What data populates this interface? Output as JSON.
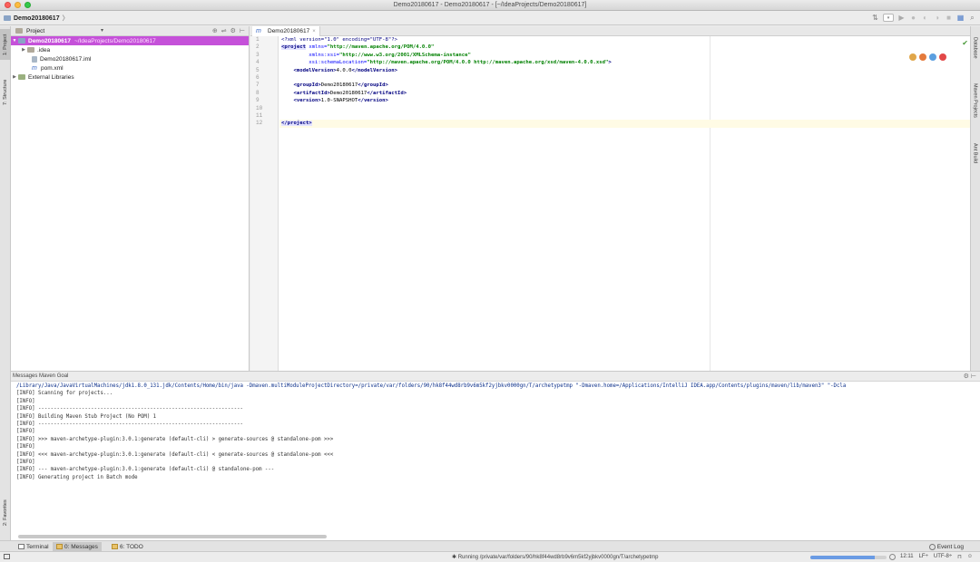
{
  "window": {
    "title": "Demo20180617 - Demo20180617 - [~/IdeaProjects/Demo20180617]"
  },
  "navbar": {
    "crumb": "Demo20180617"
  },
  "left_stripe": {
    "project_tab": "1: Project",
    "structure_tab": "7: Structure",
    "favorites_tab": "2: Favorites"
  },
  "right_stripe": {
    "database_tab": "Database",
    "maven_tab": "Maven Projects",
    "ant_tab": "Ant Build"
  },
  "project_panel": {
    "header": "Project",
    "tree": [
      {
        "name": "Demo20180617",
        "path": "~/IdeaProjects/Demo20180617"
      },
      {
        "name": ".idea"
      },
      {
        "name": "Demo20180617.iml"
      },
      {
        "name": "pom.xml"
      },
      {
        "name": "External Libraries"
      }
    ]
  },
  "editor": {
    "tab_label": "Demo20180617",
    "line_numbers": [
      "1",
      "2",
      "3",
      "4",
      "5",
      "6",
      "7",
      "8",
      "9",
      "10",
      "11",
      "12"
    ],
    "code": {
      "l1": "<?xml version=\"1.0\" encoding=\"UTF-8\"?>",
      "l2_tag": "<project",
      "l2_attr": " xmlns=",
      "l2_val": "\"http://maven.apache.org/POM/4.0.0\"",
      "l3_attr": "         xmlns:xsi=",
      "l3_val": "\"http://www.w3.org/2001/XMLSchema-instance\"",
      "l4_attr": "         xsi:schemaLocation=",
      "l4_val": "\"http://maven.apache.org/POM/4.0.0 http://maven.apache.org/xsd/maven-4.0.0.xsd\"",
      "l4_end": ">",
      "l5_open": "    <modelVersion>",
      "l5_text": "4.0.0",
      "l5_close": "</modelVersion>",
      "l7_open": "    <groupId>",
      "l7_text": "Demo20180617",
      "l7_close": "</groupId>",
      "l8_open": "    <artifactId>",
      "l8_text": "Demo20180617",
      "l8_close": "</artifactId>",
      "l9_open": "    <version>",
      "l9_text": "1.0-SNAPSHOT",
      "l9_close": "</version>",
      "l12": "</project>"
    }
  },
  "messages": {
    "header": "Messages Maven Goal",
    "lines": [
      "/Library/Java/JavaVirtualMachines/jdk1.8.0_131.jdk/Contents/Home/bin/java -Dmaven.multiModuleProjectDirectory=/private/var/folders/90/hk8f44wd8rb9v6m5kf2yjbkv0000gn/T/archetypetmp \"-Dmaven.home=/Applications/IntelliJ IDEA.app/Contents/plugins/maven/lib/maven3\" \"-Dcla",
      "[INFO] Scanning for projects...",
      "[INFO]",
      "[INFO] ------------------------------------------------------------------",
      "[INFO] Building Maven Stub Project (No POM) 1",
      "[INFO] ------------------------------------------------------------------",
      "[INFO]",
      "[INFO] >>> maven-archetype-plugin:3.0.1:generate (default-cli) > generate-sources @ standalone-pom >>>",
      "[INFO]",
      "[INFO] <<< maven-archetype-plugin:3.0.1:generate (default-cli) < generate-sources @ standalone-pom <<<",
      "[INFO]",
      "[INFO] --- maven-archetype-plugin:3.0.1:generate (default-cli) @ standalone-pom ---",
      "[INFO] Generating project in Batch mode"
    ]
  },
  "bottom_tabs": {
    "terminal": "Terminal",
    "messages": "0: Messages",
    "todo": "6: TODO",
    "event_log": "Event Log"
  },
  "status": {
    "running": "Running /private/var/folders/90/hk8f44wd8rb9v6m5kf2yjbkv0000gn/T/archetypetmp",
    "position": "12:11",
    "line_sep": "LF÷",
    "encoding": "UTF-8÷",
    "progress": 0.85
  },
  "colors": {
    "selection": "#c551d9",
    "tag": "#000080",
    "attr": "#0000ff",
    "value": "#008000"
  }
}
